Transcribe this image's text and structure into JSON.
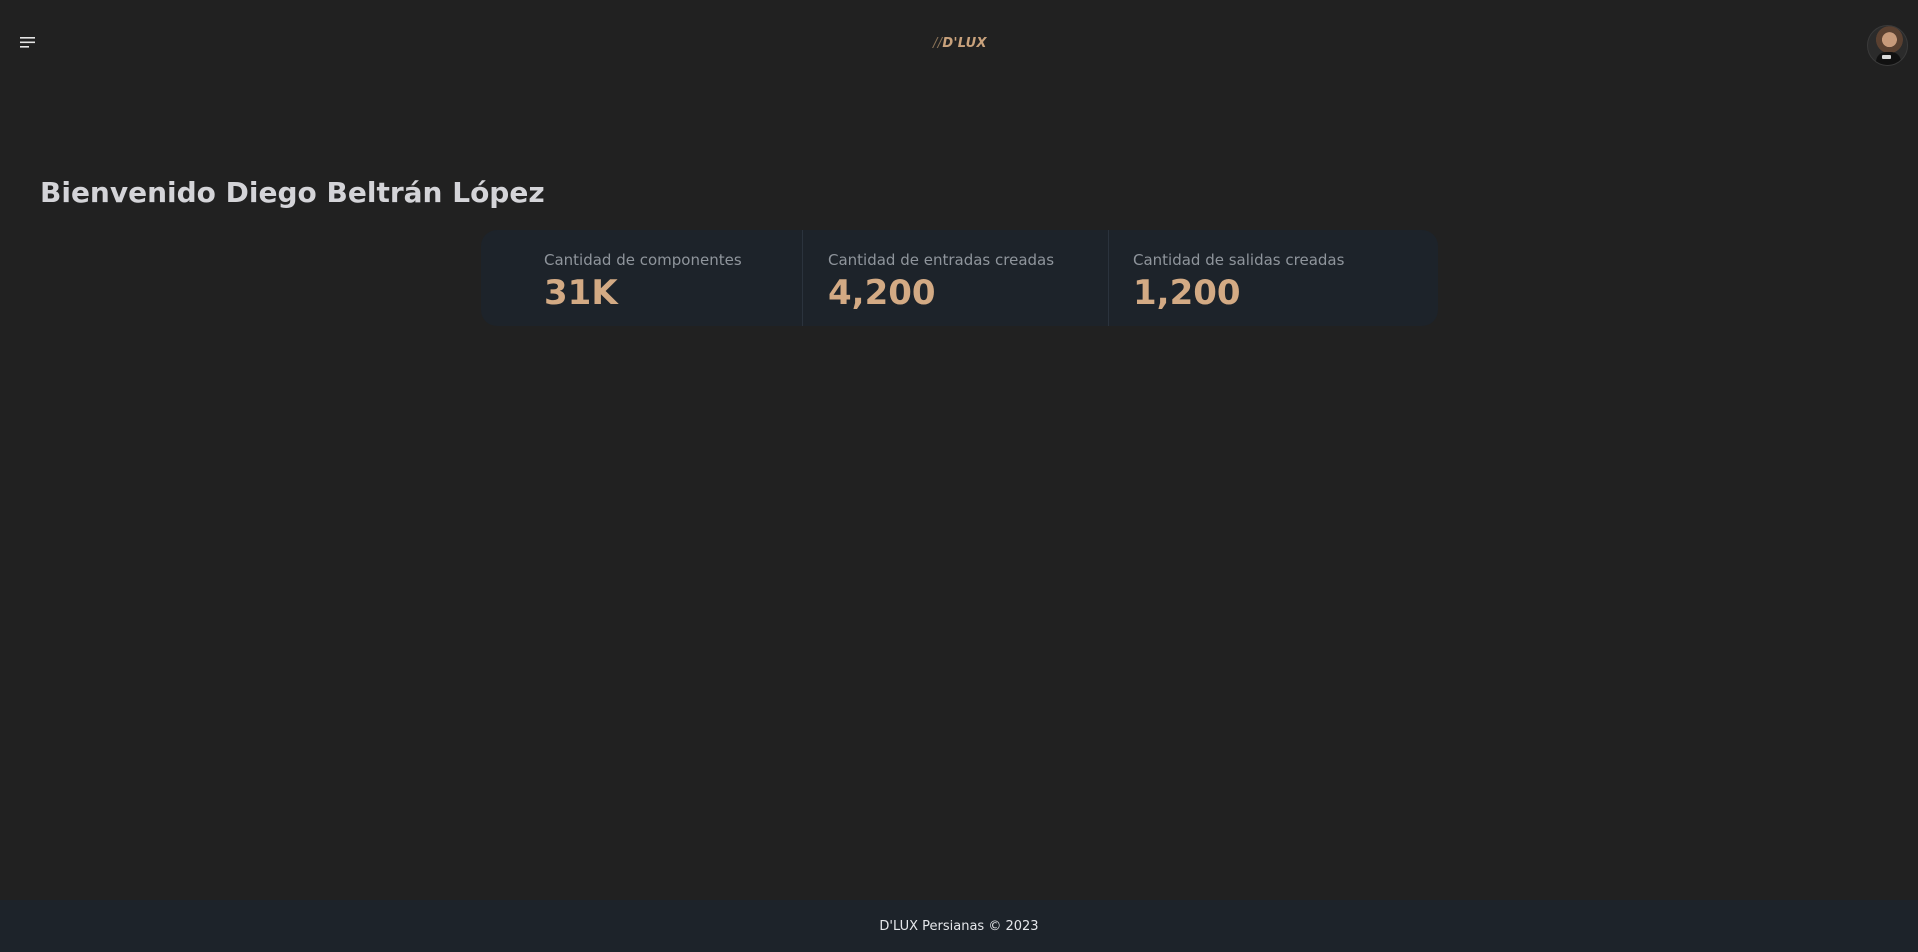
{
  "navbar": {
    "menu_icon": "hamburger-menu-icon",
    "logo_slashes": "//",
    "logo_text": "D'LUX",
    "avatar_icon": "user-avatar"
  },
  "main": {
    "welcome": "Bienvenido Diego Beltrán López",
    "stats": [
      {
        "title": "Cantidad de componentes",
        "value": "31K"
      },
      {
        "title": "Cantidad de entradas creadas",
        "value": "4,200"
      },
      {
        "title": "Cantidad de salidas creadas",
        "value": "1,200"
      }
    ]
  },
  "footer": {
    "text": "D'LUX Persianas © 2023"
  },
  "colors": {
    "background": "#212121",
    "card": "#1d232a",
    "accent": "#d3aa84",
    "muted_text": "#8f959c"
  }
}
